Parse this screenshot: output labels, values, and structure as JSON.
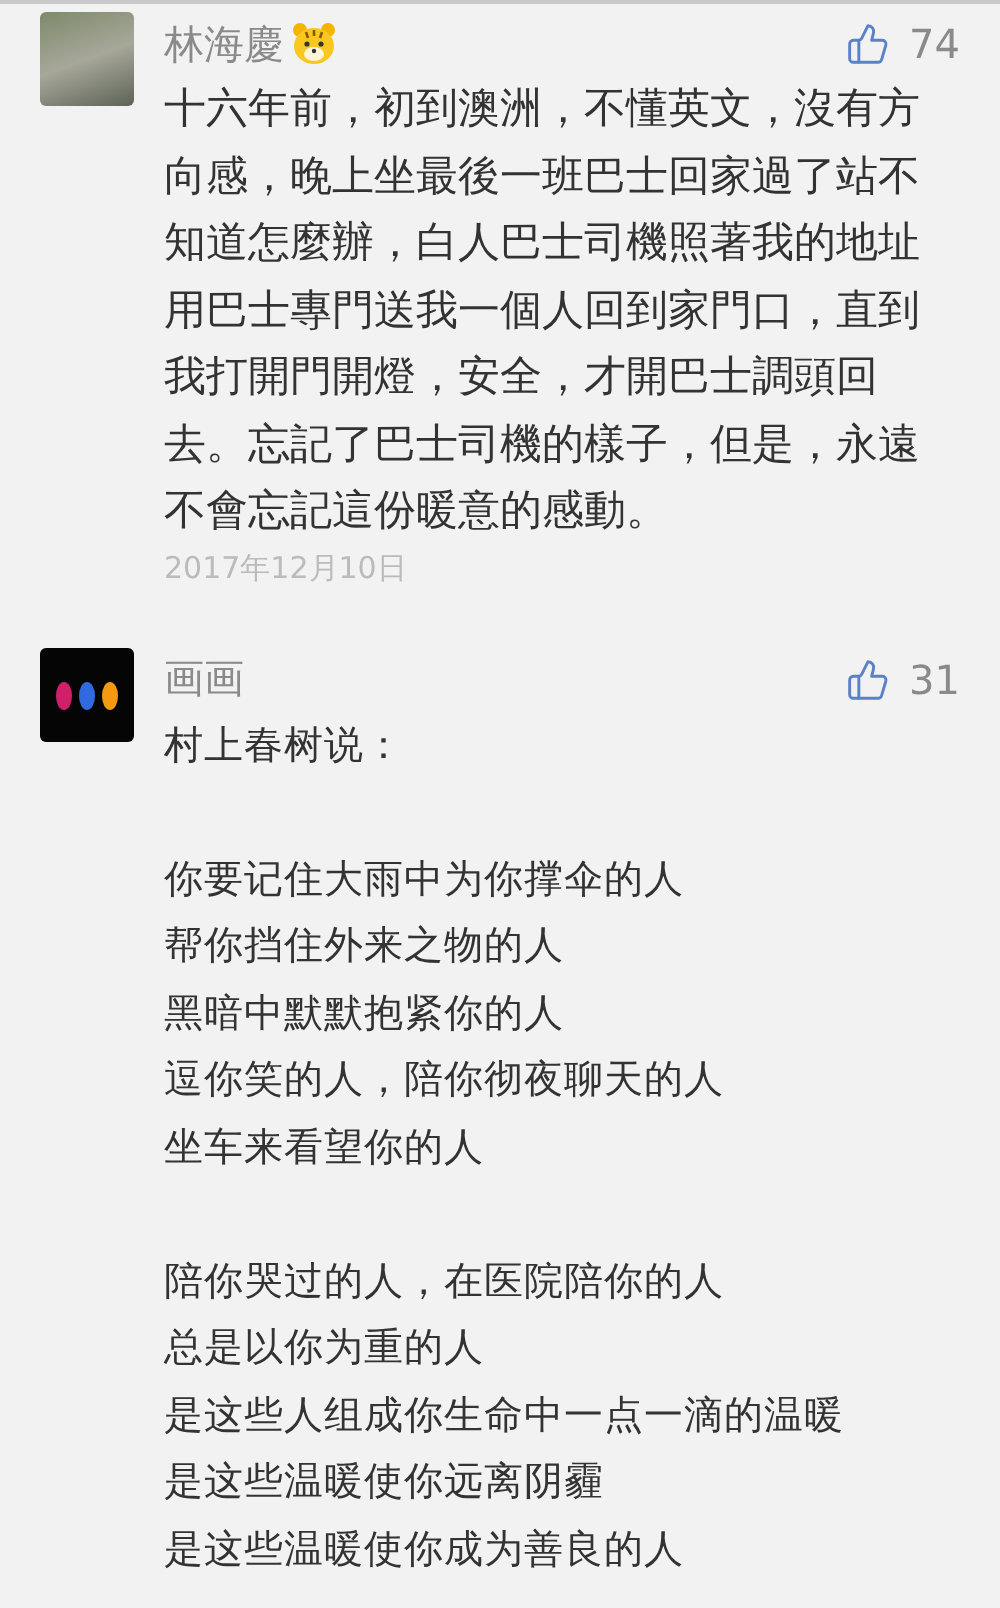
{
  "comments": [
    {
      "author": "林海慶",
      "author_badge": true,
      "likes": "74",
      "kind": "photo",
      "text": "十六年前，初到澳洲，不懂英文，沒有方向感，晚上坐最後一班巴士回家過了站不知道怎麼辦，白人巴士司機照著我的地址用巴士專門送我一個人回到家門口，直到我打開門開燈，安全，才開巴士調頭回去。忘記了巴士司機的樣子，但是，永遠不會忘記這份暖意的感動。",
      "date": "2017年12月10日"
    },
    {
      "author": "画画",
      "author_badge": false,
      "likes": "31",
      "kind": "artwork",
      "paragraphs": [
        [
          "村上春树说："
        ],
        [
          "你要记住大雨中为你撑伞的人",
          "帮你挡住外来之物的人",
          "黑暗中默默抱紧你的人",
          "逗你笑的人，陪你彻夜聊天的人",
          "坐车来看望你的人"
        ],
        [
          "陪你哭过的人，在医院陪你的人",
          "总是以你为重的人",
          "是这些人组成你生命中一点一滴的温暖",
          "是这些温暖使你远离阴霾",
          "是这些温暖使你成为善良的人"
        ]
      ]
    }
  ]
}
